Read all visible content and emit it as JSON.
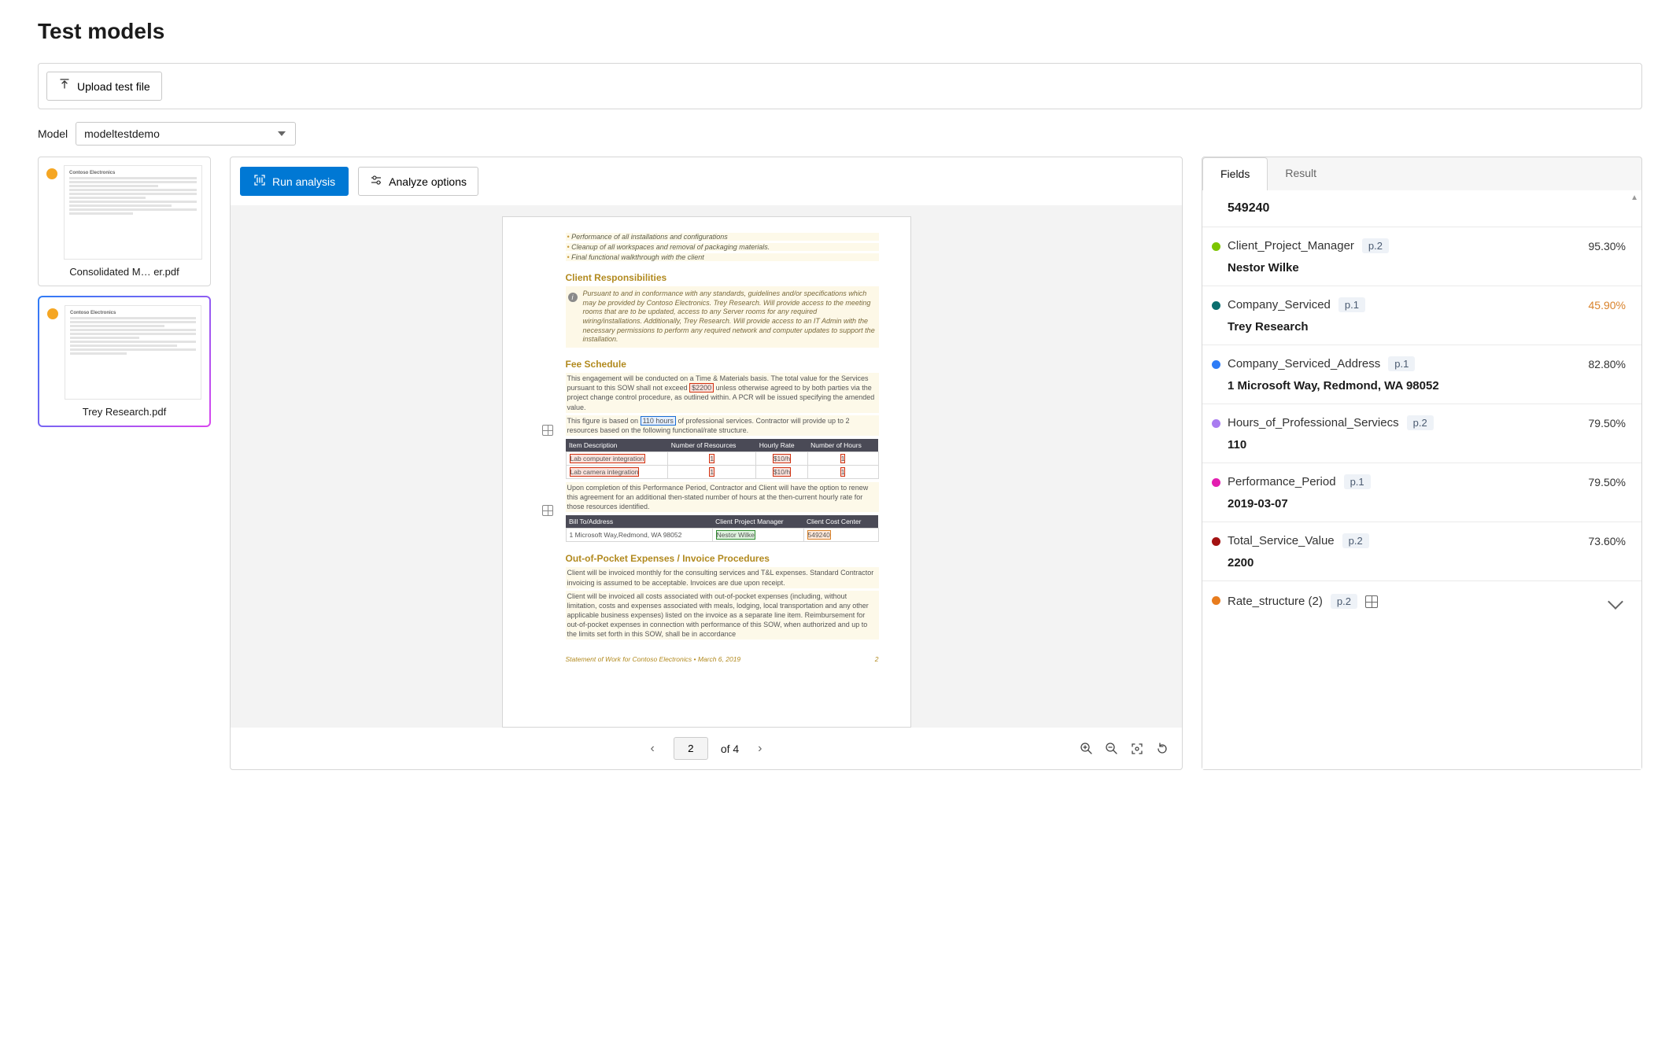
{
  "page_title": "Test models",
  "upload_button": "Upload test file",
  "model_label": "Model",
  "model_selected": "modeltestdemo",
  "run_button": "Run analysis",
  "options_button": "Analyze options",
  "thumbs": [
    {
      "name": "Consolidated M… er.pdf",
      "selected": false
    },
    {
      "name": "Trey Research.pdf",
      "selected": true
    }
  ],
  "pager": {
    "current": "2",
    "of_text": "of 4"
  },
  "tabs": {
    "fields": "Fields",
    "result": "Result"
  },
  "top_value": "549240",
  "fields": [
    {
      "color": "#7cc500",
      "name": "Client_Project_Manager",
      "page": "p.2",
      "conf": "95.30%",
      "low": false,
      "value": "Nestor Wilke"
    },
    {
      "color": "#0b6e6e",
      "name": "Company_Serviced",
      "page": "p.1",
      "conf": "45.90%",
      "low": true,
      "value": "Trey Research"
    },
    {
      "color": "#2e7cf6",
      "name": "Company_Serviced_Address",
      "page": "p.1",
      "conf": "82.80%",
      "low": false,
      "value": "1 Microsoft Way, Redmond, WA 98052"
    },
    {
      "color": "#a97cf0",
      "name": "Hours_of_Professional_Serviecs",
      "page": "p.2",
      "conf": "79.50%",
      "low": false,
      "value": "110"
    },
    {
      "color": "#e31eb0",
      "name": "Performance_Period",
      "page": "p.1",
      "conf": "79.50%",
      "low": false,
      "value": "2019-03-07"
    },
    {
      "color": "#a31212",
      "name": "Total_Service_Value",
      "page": "p.2",
      "conf": "73.60%",
      "low": false,
      "value": "2200"
    }
  ],
  "rate_row": {
    "color": "#e87c1e",
    "name": "Rate_structure (2)",
    "page": "p.2"
  },
  "doc": {
    "bullets": [
      "Performance of all installations and configurations",
      "Cleanup of all workspaces and removal of packaging materials.",
      "Final functional walkthrough with the client"
    ],
    "h_client": "Client Responsibilities",
    "client_note": "Pursuant to and in conformance with any standards, guidelines and/or specifications which may be provided by Contoso Electronics. Trey Research. Will provide access to the meeting rooms that are to be updated, access to any Server rooms for any required wiring/installations. Additionally, Trey Research. Will provide access to an IT Admin with the necessary permissions to perform any required network and computer updates to support the installation.",
    "h_fee": "Fee Schedule",
    "fee_p1a": "This engagement will be conducted on a Time & Materials basis. The total value for the Services pursuant to this SOW shall not exceed ",
    "fee_total": "$2200",
    "fee_p1b": " unless otherwise agreed to by both parties via the project change control procedure, as outlined within. A PCR will be issued specifying the amended value.",
    "fee_p2a": "This figure is based on ",
    "fee_hours": "110 hours",
    "fee_p2b": " of professional services. Contractor will provide up to 2 resources based on the following functional/rate structure.",
    "rate_table": {
      "headers": [
        "Item Description",
        "Number of Resources",
        "Hourly Rate",
        "Number of Hours"
      ],
      "rows": [
        {
          "desc": "Lab computer integration",
          "res": "1",
          "rate": "$10/h",
          "hours": "1"
        },
        {
          "desc": "Lab camera integration",
          "res": "1",
          "rate": "$10/h",
          "hours": "1"
        }
      ]
    },
    "perf_p": "Upon completion of this Performance Period, Contractor and Client will have the option to renew this agreement for an additional then-stated number of hours at the then-current hourly rate for those resources identified.",
    "bill_table": {
      "headers": [
        "Bill To/Address",
        "Client Project Manager",
        "Client Cost Center"
      ],
      "row": {
        "addr": "1 Microsoft Way,Redmond, WA 98052",
        "pm": "Nestor Wilke",
        "cc": "549240"
      }
    },
    "h_oop": "Out-of-Pocket Expenses / Invoice Procedures",
    "oop_p1": "Client will be invoiced monthly for the consulting services and T&L expenses. Standard Contractor invoicing is assumed to be acceptable. Invoices are due upon receipt.",
    "oop_p2": "Client will be invoiced all costs associated with out-of-pocket expenses (including, without limitation, costs and expenses associated with meals, lodging, local transportation and any other applicable business expenses) listed on the invoice as a separate line item. Reimbursement for out-of-pocket expenses in connection with performance of this SOW, when authorized and up to the limits set forth in this SOW, shall be in accordance",
    "footer_left": "Statement of Work for Contoso Electronics • March 6, 2019",
    "footer_right": "2"
  }
}
